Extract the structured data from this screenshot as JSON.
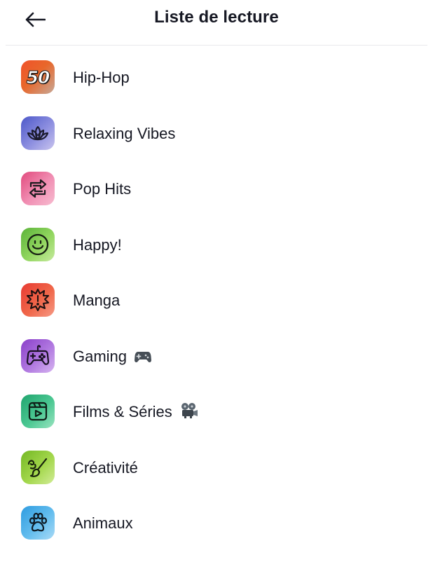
{
  "header": {
    "title": "Liste de lecture",
    "back_icon": "arrow-left-icon"
  },
  "playlists": [
    {
      "label": "Hip-Hop",
      "icon": "fifty-badge-icon",
      "icon_text": "50",
      "color": "#f0522a"
    },
    {
      "label": "Relaxing Vibes",
      "icon": "lotus-icon",
      "color": "#7b7fd6"
    },
    {
      "label": "Pop Hits",
      "icon": "repeat-arrows-icon",
      "color": "#f07ca8"
    },
    {
      "label": "Happy!",
      "icon": "smiley-icon",
      "color": "#8ad05a"
    },
    {
      "label": "Manga",
      "icon": "exclamation-burst-icon",
      "color": "#ef5640"
    },
    {
      "label": "Gaming",
      "icon": "gamepad-icon",
      "color": "#a561d8",
      "emoji": "🎮"
    },
    {
      "label": "Films & Séries",
      "icon": "video-play-icon",
      "color": "#3fc08a",
      "emoji": "📽"
    },
    {
      "label": "Créativité",
      "icon": "paintbrush-icon",
      "color": "#98cf3f"
    },
    {
      "label": "Animaux",
      "icon": "paw-icon",
      "color": "#58b6ea"
    }
  ]
}
